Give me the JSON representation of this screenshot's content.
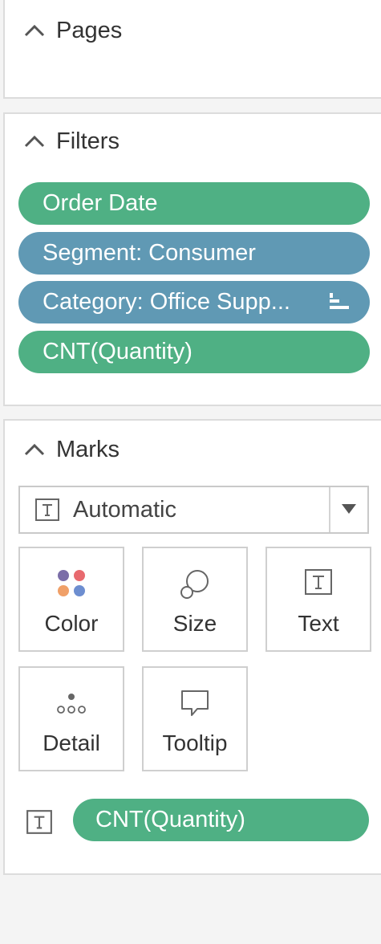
{
  "pages": {
    "title": "Pages"
  },
  "filters": {
    "title": "Filters",
    "items": [
      {
        "label": "Order Date",
        "color": "#4fb084"
      },
      {
        "label": "Segment: Consumer",
        "color": "#6099b4"
      },
      {
        "label": "Category: Office Supp...",
        "color": "#6099b4"
      },
      {
        "label": "CNT(Quantity)",
        "color": "#4fb084"
      }
    ]
  },
  "marks": {
    "title": "Marks",
    "mark_type": "Automatic",
    "tiles": {
      "color": "Color",
      "size": "Size",
      "text": "Text",
      "detail": "Detail",
      "tooltip": "Tooltip"
    },
    "field_pill": {
      "label": "CNT(Quantity)",
      "color": "#4fb084",
      "encoding_icon": "text-icon"
    }
  },
  "colors": {
    "measure_green": "#4fb084",
    "dimension_blue": "#6099b4",
    "color_dots": [
      "#7b6ea8",
      "#e86a6f",
      "#f0a068",
      "#6d8ed0"
    ]
  }
}
